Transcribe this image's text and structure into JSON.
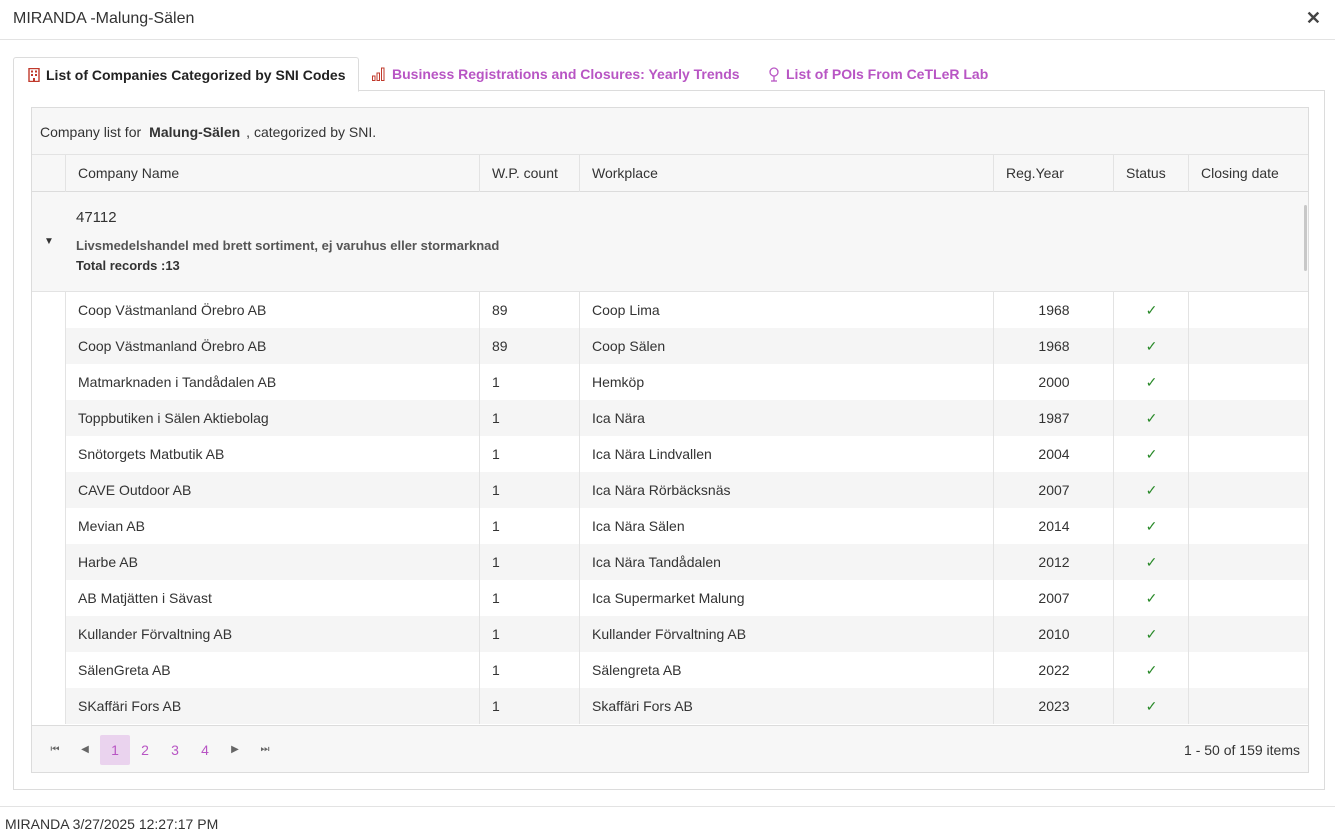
{
  "window": {
    "title": "MIRANDA -Malung-Sälen",
    "close_label": "✕"
  },
  "tabs": [
    {
      "label": "List of Companies Categorized by SNI Codes",
      "icon": "building-icon",
      "active": true
    },
    {
      "label": "Business Registrations and Closures: Yearly Trends",
      "icon": "bar-chart-icon",
      "active": false
    },
    {
      "label": "List of POIs From CeTLeR Lab",
      "icon": "map-pin-icon",
      "active": false
    }
  ],
  "toolbar": {
    "prefix": "Company list for",
    "place": "Malung-Sälen",
    "suffix": ", categorized by SNI."
  },
  "columns": [
    "Company Name",
    "W.P. count",
    "Workplace",
    "Reg.Year",
    "Status",
    "Closing date"
  ],
  "group": {
    "code": "47112",
    "description": "Livsmedelshandel med brett sortiment, ej varuhus eller stormarknad",
    "total": "Total records :13"
  },
  "rows": [
    {
      "company": "Coop Västmanland Örebro AB",
      "count": "89",
      "workplace": "Coop Lima",
      "year": "1968",
      "status": "✓",
      "closing": ""
    },
    {
      "company": "Coop Västmanland Örebro AB",
      "count": "89",
      "workplace": "Coop Sälen",
      "year": "1968",
      "status": "✓",
      "closing": ""
    },
    {
      "company": "Matmarknaden i Tandådalen AB",
      "count": "1",
      "workplace": "Hemköp",
      "year": "2000",
      "status": "✓",
      "closing": ""
    },
    {
      "company": "Toppbutiken i Sälen Aktiebolag",
      "count": "1",
      "workplace": "Ica Nära",
      "year": "1987",
      "status": "✓",
      "closing": ""
    },
    {
      "company": "Snötorgets Matbutik AB",
      "count": "1",
      "workplace": "Ica Nära Lindvallen",
      "year": "2004",
      "status": "✓",
      "closing": ""
    },
    {
      "company": "CAVE Outdoor AB",
      "count": "1",
      "workplace": "Ica Nära Rörbäcksnäs",
      "year": "2007",
      "status": "✓",
      "closing": ""
    },
    {
      "company": "Mevian AB",
      "count": "1",
      "workplace": "Ica Nära Sälen",
      "year": "2014",
      "status": "✓",
      "closing": ""
    },
    {
      "company": "Harbe AB",
      "count": "1",
      "workplace": "Ica Nära Tandådalen",
      "year": "2012",
      "status": "✓",
      "closing": ""
    },
    {
      "company": "AB Matjätten i Sävast",
      "count": "1",
      "workplace": "Ica Supermarket Malung",
      "year": "2007",
      "status": "✓",
      "closing": ""
    },
    {
      "company": "Kullander Förvaltning AB",
      "count": "1",
      "workplace": "Kullander Förvaltning AB",
      "year": "2010",
      "status": "✓",
      "closing": ""
    },
    {
      "company": "SälenGreta AB",
      "count": "1",
      "workplace": "Sälengreta AB",
      "year": "2022",
      "status": "✓",
      "closing": ""
    },
    {
      "company": "SKaffäri Fors AB",
      "count": "1",
      "workplace": "Skaffäri Fors AB",
      "year": "2023",
      "status": "✓",
      "closing": ""
    }
  ],
  "pager": {
    "first": "⏮",
    "prev": "◀",
    "next": "▶",
    "last": "⏭",
    "pages": [
      "1",
      "2",
      "3",
      "4"
    ],
    "current": "1",
    "info": "1 - 50 of 159 items"
  },
  "footer": {
    "text": "MIRANDA 3/27/2025 12:27:17 PM"
  },
  "colors": {
    "accent": "#b855c4",
    "check": "#2a8a2a",
    "page_selected_bg": "#ead3ee"
  }
}
